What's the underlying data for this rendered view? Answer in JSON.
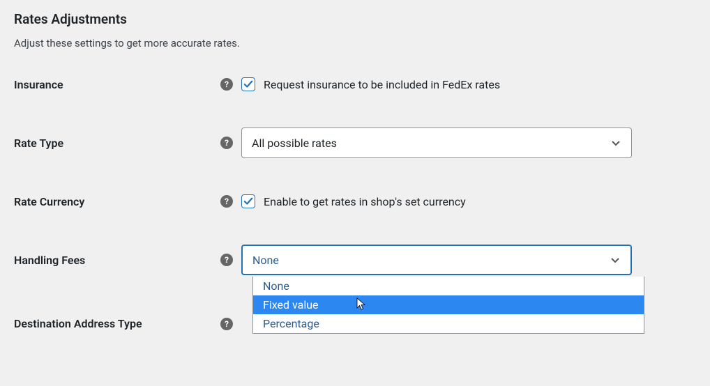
{
  "section": {
    "title": "Rates Adjustments",
    "description": "Adjust these settings to get more accurate rates."
  },
  "insurance": {
    "label": "Insurance",
    "checkbox_label": "Request insurance to be included in FedEx rates",
    "checked": true
  },
  "rate_type": {
    "label": "Rate Type",
    "selected": "All possible rates"
  },
  "rate_currency": {
    "label": "Rate Currency",
    "checkbox_label": "Enable to get rates in shop's set currency",
    "checked": true
  },
  "handling_fees": {
    "label": "Handling Fees",
    "selected": "None",
    "options": [
      "None",
      "Fixed value",
      "Percentage"
    ],
    "highlighted_index": 1
  },
  "destination_address_type": {
    "label": "Destination Address Type"
  }
}
